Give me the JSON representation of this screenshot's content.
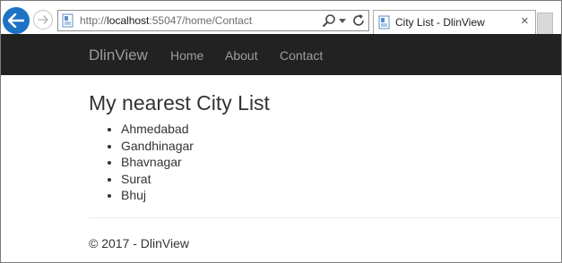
{
  "browser": {
    "url_prefix": "http://",
    "url_host": "localhost",
    "url_path": ":55047/home/Contact",
    "tab_title": "City List - DlinView",
    "tab_close": "×",
    "icons": {
      "back": "back-arrow-icon",
      "forward": "forward-arrow-icon",
      "page": "page-icon",
      "search": "search-icon",
      "dropdown": "dropdown-icon",
      "refresh": "refresh-icon",
      "close": "close-icon"
    },
    "accent_color": "#1d73c4"
  },
  "navbar": {
    "brand": "DlinView",
    "links": [
      "Home",
      "About",
      "Contact"
    ],
    "background": "#222222",
    "text_color": "#9d9d9d"
  },
  "main": {
    "title": "My nearest City List",
    "cities": [
      "Ahmedabad",
      "Gandhinagar",
      "Bhavnagar",
      "Surat",
      "Bhuj"
    ]
  },
  "footer": {
    "text": "© 2017 - DlinView"
  }
}
